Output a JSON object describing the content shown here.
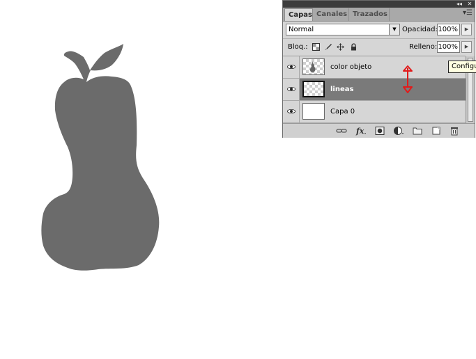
{
  "panel": {
    "tabs": [
      {
        "label": "Capas",
        "active": true
      },
      {
        "label": "Canales",
        "active": false
      },
      {
        "label": "Trazados",
        "active": false
      }
    ],
    "blend_mode": "Normal",
    "opacity_label": "Opacidad:",
    "opacity_value": "100%",
    "lock_label": "Bloq.:",
    "fill_label": "Relleno:",
    "fill_value": "100%",
    "layers": [
      {
        "name": "color objeto",
        "visible": true,
        "selected": false,
        "thumb": "checker-pear"
      },
      {
        "name": "lineas",
        "visible": true,
        "selected": true,
        "thumb": "checker"
      },
      {
        "name": "Capa 0",
        "visible": true,
        "selected": false,
        "thumb": "white"
      }
    ]
  },
  "tooltip": {
    "text": "Configu"
  },
  "colors": {
    "pear_fill": "#6b6b6b",
    "annotation_red": "#e11b1b",
    "selected_layer": "#7a7a7a",
    "panel_bg": "#d6d6d6"
  },
  "icons": [
    "eye-icon",
    "lock-transparency-icon",
    "lock-brush-icon",
    "lock-move-icon",
    "lock-all-icon",
    "link-layers-icon",
    "fx-icon",
    "mask-icon",
    "adjustment-icon",
    "group-folder-icon",
    "new-layer-icon",
    "trash-icon"
  ]
}
